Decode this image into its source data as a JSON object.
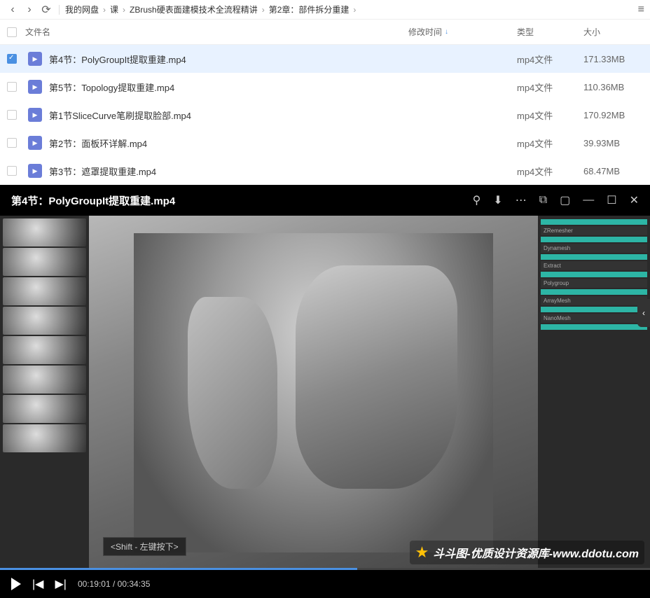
{
  "nav": {
    "breadcrumbs": [
      "我的网盘",
      "课",
      "ZBrush硬表面建模技术全流程精讲",
      "第2章：部件拆分重建"
    ]
  },
  "table": {
    "headers": {
      "name": "文件名",
      "time": "修改时间",
      "type": "类型",
      "size": "大小"
    },
    "files": [
      {
        "name": "第4节：PolyGroupIt提取重建.mp4",
        "type": "mp4文件",
        "size": "171.33MB",
        "selected": true
      },
      {
        "name": "第5节：Topology提取重建.mp4",
        "type": "mp4文件",
        "size": "110.36MB",
        "selected": false
      },
      {
        "name": "第1节SliceCurve笔刷提取脸部.mp4",
        "type": "mp4文件",
        "size": "170.92MB",
        "selected": false
      },
      {
        "name": "第2节：面板环详解.mp4",
        "type": "mp4文件",
        "size": "39.93MB",
        "selected": false
      },
      {
        "name": "第3节：遮罩提取重建.mp4",
        "type": "mp4文件",
        "size": "68.47MB",
        "selected": false
      }
    ]
  },
  "video": {
    "title": "第4节：PolyGroupIt提取重建.mp4",
    "currentTime": "00:19:01",
    "duration": "00:34:35",
    "hint": "<Shift - 左键按下>",
    "watermark": "斗斗图-优质设计资源库-www.ddotu.com"
  }
}
